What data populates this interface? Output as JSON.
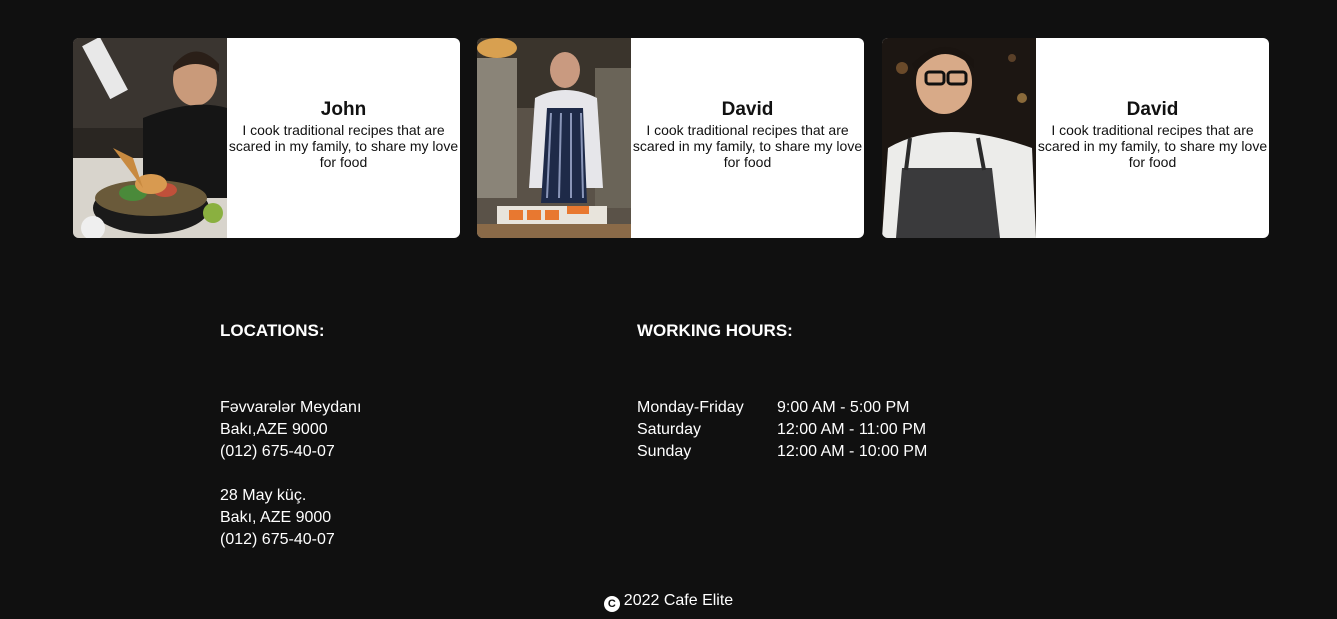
{
  "chefs": [
    {
      "name": "John",
      "bio": "I cook traditional recipes that are scared in my family, to share my love for food",
      "photo_icon": "chef-plating-photo"
    },
    {
      "name": "David",
      "bio": "I cook traditional recipes that are scared in my family, to share my love for food",
      "photo_icon": "chef-cutting-carrots-photo"
    },
    {
      "name": "David",
      "bio": "I cook traditional recipes that are scared in my family, to share my love for food",
      "photo_icon": "chef-portrait-photo"
    }
  ],
  "locations": {
    "title": "LOCATIONS:",
    "addresses": [
      {
        "street": "Fəvvarələr Meydanı",
        "city": "Bakı,AZE 9000",
        "phone": "(012) 675-40-07"
      },
      {
        "street": "28 May küç.",
        "city": "Bakı, AZE 9000",
        "phone": "(012) 675-40-07"
      }
    ]
  },
  "hours": {
    "title": "WORKING HOURS:",
    "rows": [
      {
        "day": "Monday-Friday",
        "time": "9:00 AM - 5:00 PM"
      },
      {
        "day": "Saturday",
        "time": "12:00 AM - 11:00 PM"
      },
      {
        "day": "Sunday",
        "time": "12:00 AM - 10:00 PM"
      }
    ]
  },
  "footer": {
    "copyright_symbol": "C",
    "text": "2022 Cafe Elite"
  },
  "colors": {
    "background": "#101010",
    "card": "#ffffff",
    "text_light": "#ffffff",
    "text_dark": "#111111"
  }
}
